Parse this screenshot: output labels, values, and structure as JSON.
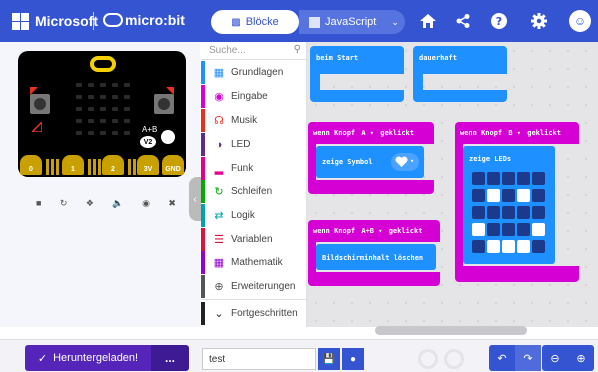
{
  "header": {
    "brand": "Microsoft",
    "product": "micro:bit",
    "tabs": [
      {
        "label": "Blöcke",
        "icon": "blocks-icon"
      },
      {
        "label": "JavaScript",
        "icon": "javascript-icon"
      }
    ],
    "icons": [
      "home-icon",
      "share-icon",
      "help-icon",
      "settings-icon",
      "account-icon"
    ]
  },
  "simulator": {
    "board_labels": {
      "ab": "A+B",
      "version": "V2",
      "pins": [
        "0",
        "1",
        "2",
        "3V",
        "GND"
      ]
    },
    "tools": [
      "stop-icon",
      "restart-icon",
      "debug-icon",
      "mute-icon",
      "screenshot-icon",
      "fullscreen-icon"
    ]
  },
  "toolbox": {
    "search_placeholder": "Suche...",
    "categories": [
      {
        "label": "Grundlagen",
        "color": "#1e90ff"
      },
      {
        "label": "Eingabe",
        "color": "#d400d4"
      },
      {
        "label": "Musik",
        "color": "#e63022"
      },
      {
        "label": "LED",
        "color": "#5c2d91"
      },
      {
        "label": "Funk",
        "color": "#e3008c"
      },
      {
        "label": "Schleifen",
        "color": "#00aa00"
      },
      {
        "label": "Logik",
        "color": "#00a4a6"
      },
      {
        "label": "Variablen",
        "color": "#dc143c"
      },
      {
        "label": "Mathematik",
        "color": "#9400d3"
      },
      {
        "label": "Erweiterungen",
        "color": "#555555"
      },
      {
        "label": "Fortgeschritten",
        "color": "#222222"
      }
    ]
  },
  "workspace": {
    "blocks": {
      "on_start": "beim Start",
      "forever": "dauerhaft",
      "button_a": {
        "prefix": "wenn Knopf",
        "button": "A",
        "suffix": "geklickt"
      },
      "show_icon": "zeige Symbol",
      "button_b": {
        "prefix": "wenn Knopf",
        "button": "B",
        "suffix": "geklickt"
      },
      "show_leds": "zeige LEDs",
      "button_ab": {
        "prefix": "wenn Knopf",
        "button": "A+B",
        "suffix": "geklickt"
      },
      "clear_screen": "Bildschirminhalt löschen"
    },
    "colors": {
      "basic": "#1e90ff",
      "input": "#d400d4"
    }
  },
  "footer": {
    "download_label": "Heruntergeladen!",
    "more_label": "...",
    "project_name": "test"
  }
}
